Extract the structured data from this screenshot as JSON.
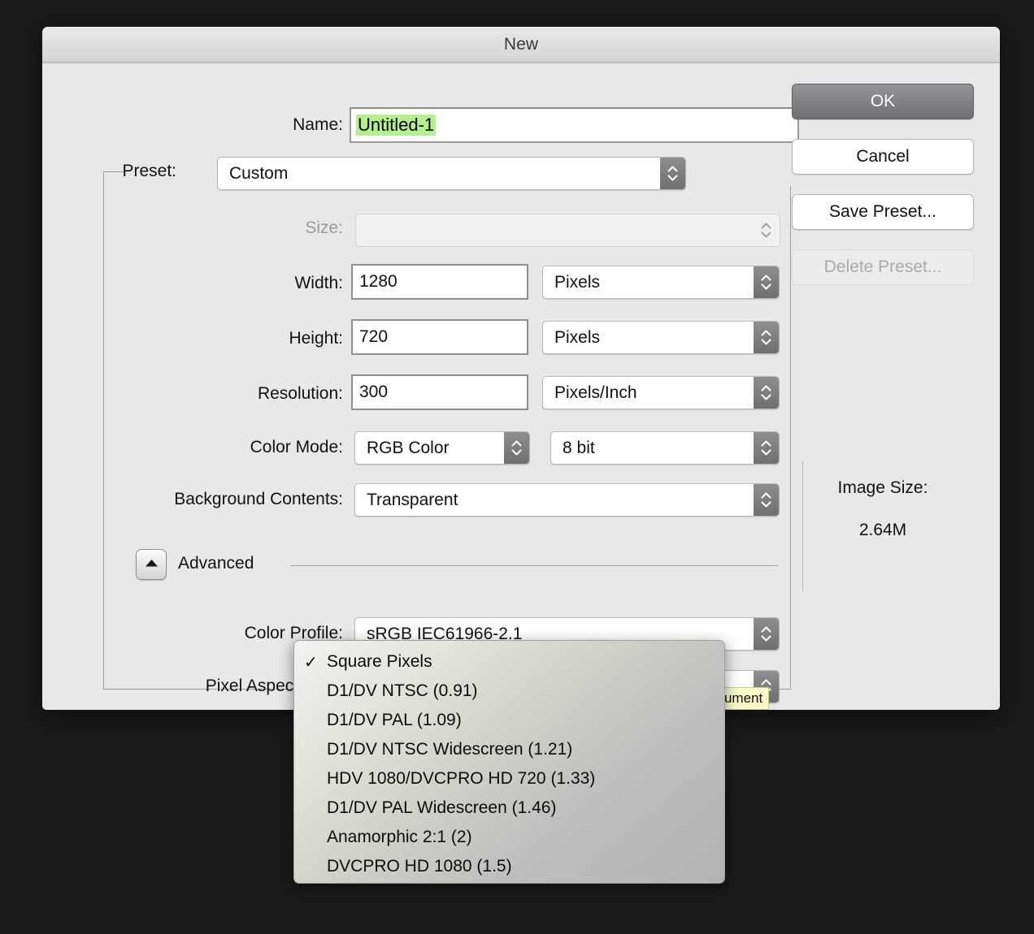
{
  "window": {
    "title": "New"
  },
  "name_row": {
    "label": "Name:",
    "value": "Untitled-1"
  },
  "preset_row": {
    "label": "Preset:",
    "value": "Custom"
  },
  "size_row": {
    "label": "Size:",
    "value": ""
  },
  "width_row": {
    "label": "Width:",
    "value": "1280",
    "unit": "Pixels"
  },
  "height_row": {
    "label": "Height:",
    "value": "720",
    "unit": "Pixels"
  },
  "resolution_row": {
    "label": "Resolution:",
    "value": "300",
    "unit": "Pixels/Inch"
  },
  "color_mode_row": {
    "label": "Color Mode:",
    "value": "RGB Color",
    "depth": "8 bit"
  },
  "background_row": {
    "label": "Background Contents:",
    "value": "Transparent"
  },
  "advanced": {
    "label": "Advanced",
    "toggle_icon": "disclosure-triangle-up-icon",
    "expanded": true
  },
  "color_profile_row": {
    "label": "Color Profile:",
    "value": "sRGB IEC61966-2.1"
  },
  "pixel_aspect_row": {
    "label": "Pixel Aspect Ratio",
    "value": "Square Pixels"
  },
  "buttons": {
    "ok": "OK",
    "cancel": "Cancel",
    "save_preset": "Save Preset...",
    "delete_preset": "Delete Preset..."
  },
  "image_size": {
    "label": "Image Size:",
    "value": "2.64M"
  },
  "tooltip": {
    "text": "ocument"
  },
  "pixel_aspect_menu": {
    "checked_index": 0,
    "items": [
      {
        "label": "Square Pixels",
        "checked": true
      },
      {
        "label": "D1/DV NTSC (0.91)",
        "checked": false
      },
      {
        "label": "D1/DV PAL (1.09)",
        "checked": false
      },
      {
        "label": "D1/DV NTSC Widescreen (1.21)",
        "checked": false
      },
      {
        "label": "HDV 1080/DVCPRO HD 720 (1.33)",
        "checked": false
      },
      {
        "label": "D1/DV PAL Widescreen (1.46)",
        "checked": false
      },
      {
        "label": "Anamorphic 2:1 (2)",
        "checked": false
      },
      {
        "label": "DVCPRO HD 1080 (1.5)",
        "checked": false
      }
    ]
  },
  "colors": {
    "dialog_bg": "#e8e8e8",
    "desktop_bg": "#1a1a1a",
    "selection_green": "#b4f08d",
    "tooltip_bg": "#fbfbc8",
    "ok_button": "#7a7a80"
  },
  "check_glyph": "✓"
}
